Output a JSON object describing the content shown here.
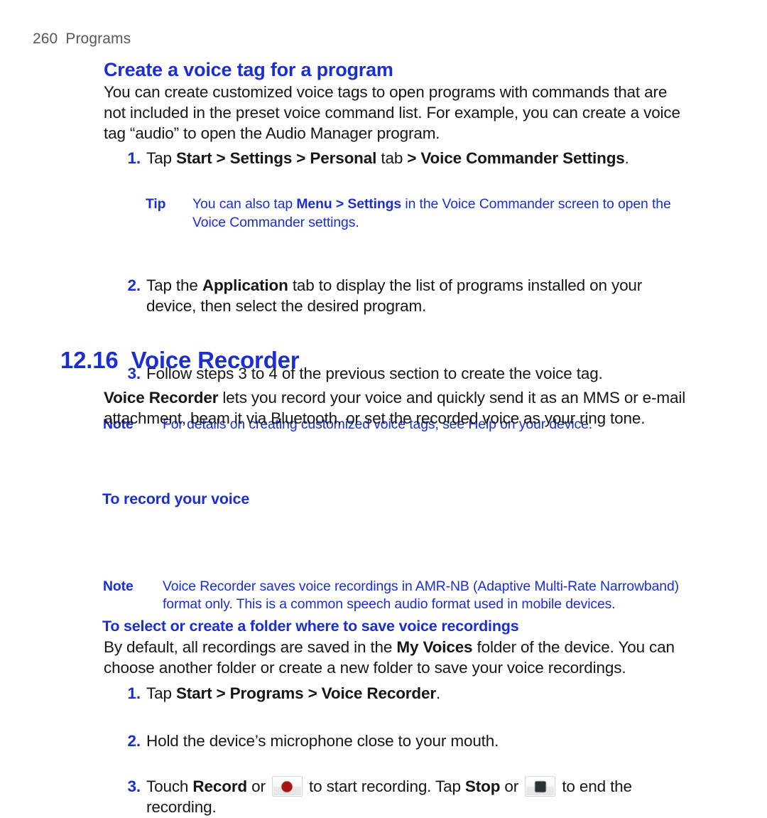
{
  "page": {
    "folio": "260",
    "running_head": "Programs",
    "header_color": "#58585c",
    "accent_color": "#1b2ed2",
    "body_color": "#15161a",
    "background": "#ffffff"
  },
  "section_voice_tag": {
    "heading": "Create a voice tag for a program",
    "intro": "You can create customized voice tags to open programs with commands that are not included in the preset voice command list. For example, you can create a voice tag “audio” to open the Audio Manager program.",
    "steps": [
      {
        "num": "1.",
        "text_html": "Tap <b>Start &gt; Settings &gt; Personal</b> tab <b>&gt; Voice Commander Settings</b>."
      },
      {
        "num": "2.",
        "text_html": "Tap the <b>Application</b> tab to display the list of programs installed on your device, then select the desired program."
      },
      {
        "num": "3.",
        "text_html": "Follow steps 3 to 4 of the previous section to create the voice tag."
      }
    ],
    "tip": {
      "label": "Tip",
      "text_html": "You can also tap <b>Menu &gt; Settings</b> in the Voice Commander screen to open the Voice Commander settings."
    },
    "note": {
      "label": "Note",
      "text_html": "For details on creating customized voice tags, see Help on your device."
    }
  },
  "section_voice_recorder": {
    "number": "12.16",
    "title": "Voice Recorder",
    "intro_html": "<b>Voice Recorder</b> lets you record your voice and quickly send it as an MMS or e-mail attachment, beam it via Bluetooth, or set the recorded voice as your ring tone.",
    "note": {
      "label": "Note",
      "text_html": "Voice Recorder saves voice recordings in AMR-NB (Adaptive Multi-Rate Narrowband) format only. This is a common speech audio format used in mobile devices."
    },
    "sub_record": {
      "heading": "To record your voice",
      "steps": [
        {
          "num": "1.",
          "text_html": "Tap <b>Start &gt; Programs &gt; Voice Recorder</b>."
        },
        {
          "num": "2.",
          "text_html": "Hold the device’s microphone close to your mouth."
        },
        {
          "num": "3.",
          "text_html": "Touch <b>Record</b> or __RECORD_BTN__ to start recording. Tap <b>Stop</b> or __STOP_BTN__ to end the recording."
        }
      ],
      "icons": {
        "record_button": "record-button-icon",
        "record_glyph_color": "#a51515",
        "stop_button": "stop-button-icon",
        "stop_glyph_color": "#2a3236"
      }
    },
    "sub_folder": {
      "heading": "To select or create a folder where to save voice recordings",
      "text_html": "By default, all recordings are saved in the <b>My Voices</b> folder of the device. You can choose another folder or create a new folder to save your voice recordings."
    }
  }
}
